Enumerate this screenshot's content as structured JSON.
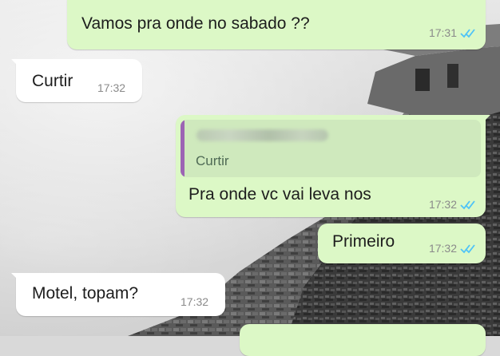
{
  "messages": [
    {
      "direction": "out",
      "text": "Vamos pra onde no sabado ??",
      "time": "17:31",
      "status": "read-double-check-icon"
    },
    {
      "direction": "in",
      "text": "Curtir",
      "time": "17:32"
    },
    {
      "direction": "out",
      "quoted": {
        "text": "Curtir",
        "author_redacted": true
      },
      "text": "Pra  onde vc vai leva nos",
      "time": "17:32",
      "status": "read-double-check-icon"
    },
    {
      "direction": "out",
      "text": "Primeiro",
      "time": "17:32",
      "status": "read-double-check-icon"
    },
    {
      "direction": "in",
      "text": "Motel,  topam?",
      "time": "17:32"
    }
  ],
  "colors": {
    "outgoing_bubble": "#dcf8c6",
    "incoming_bubble": "#ffffff",
    "read_ticks": "#4fc3f7",
    "quote_bar": "#9c64b4"
  }
}
